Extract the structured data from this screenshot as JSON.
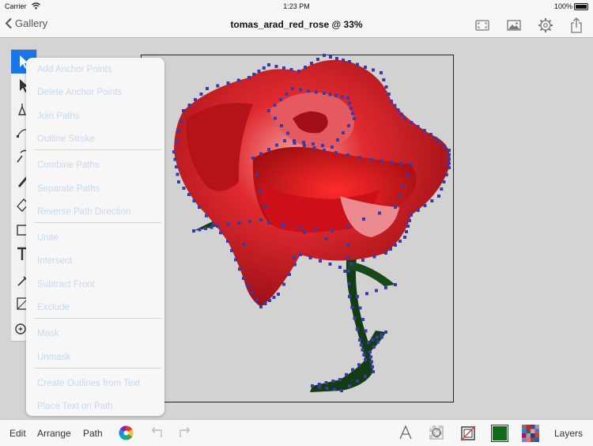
{
  "status": {
    "carrier": "Carrier",
    "time": "1:23 PM",
    "battery": "100%"
  },
  "nav": {
    "back_label": "Gallery",
    "title": "tomas_arad_red_rose @ 33%"
  },
  "menu": {
    "groups": [
      [
        "Add Anchor Points",
        "Delete Anchor Points",
        "Join Paths",
        "Outline Stroke"
      ],
      [
        "Combine Paths",
        "Separate Paths",
        "Reverse Path Direction"
      ],
      [
        "Unite",
        "Intersect",
        "Subtract Front",
        "Exclude"
      ],
      [
        "Mask",
        "Unmask"
      ],
      [
        "Create Outlines from Text",
        "Place Text on Path"
      ]
    ]
  },
  "bottom": {
    "edit": "Edit",
    "arrange": "Arrange",
    "path": "Path",
    "layers": "Layers"
  },
  "colors": {
    "accent": "#1a75e8",
    "fill_swatch": "#0f6b18",
    "rose_red": "#c8101a",
    "stem_green": "#123d14",
    "anchor": "#3a3aa8"
  },
  "icons": [
    "wifi-icon",
    "back-chevron-icon",
    "fit-screen-icon",
    "image-icon",
    "gear-icon",
    "share-icon",
    "select-arrow-icon",
    "direct-select-icon",
    "pen-icon",
    "node-icon",
    "brush-icon",
    "pencil-icon",
    "eraser-icon",
    "rectangle-icon",
    "text-icon",
    "eyedropper-icon",
    "crop-icon",
    "zoom-icon",
    "color-wheel-icon",
    "undo-icon",
    "redo-icon",
    "text-style-icon",
    "align-icon",
    "stroke-icon",
    "fill-swatch",
    "pattern-icon"
  ]
}
